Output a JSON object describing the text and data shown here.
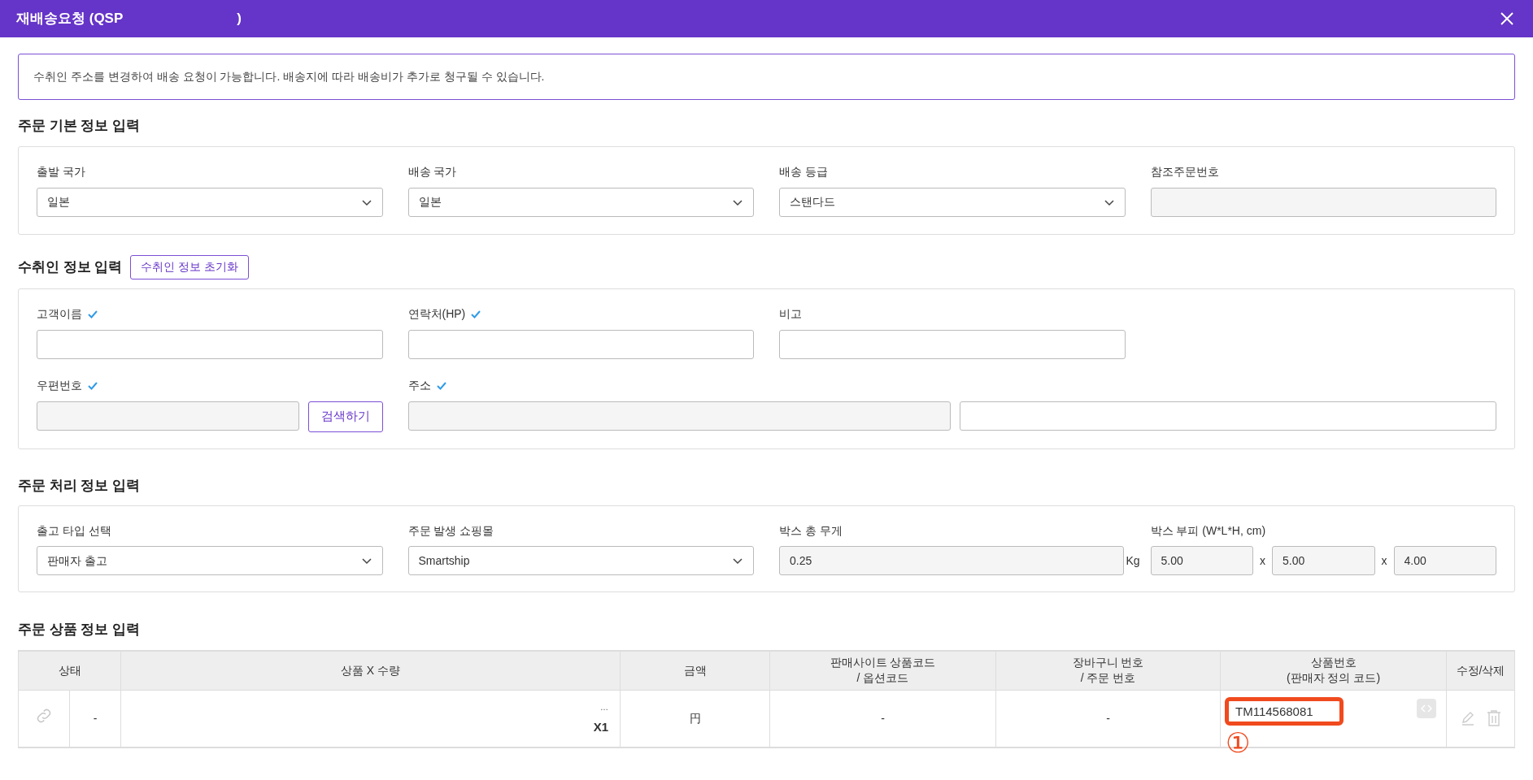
{
  "window": {
    "title": "재배송요청 (QSP",
    "title_end": ")"
  },
  "notice": "수취인 주소를 변경하여 배송 요청이 가능합니다. 배송지에 따라 배송비가 추가로 청구될 수 있습니다.",
  "basic": {
    "title": "주문 기본 정보 입력",
    "fields": [
      {
        "label": "출발 국가",
        "kind": "select",
        "value": "일본",
        "verified": false
      },
      {
        "label": "배송 국가",
        "kind": "select",
        "value": "일본",
        "verified": false
      },
      {
        "label": "배송 등급",
        "kind": "select",
        "value": "스탠다드",
        "verified": false
      },
      {
        "label": "참조주문번호",
        "kind": "readonly",
        "verified": false
      }
    ]
  },
  "recipient": {
    "title": "수취인 정보 입력",
    "reset_button": "수취인 정보 초기화",
    "fields": [
      {
        "label": "고객이름",
        "kind": "text",
        "verified": true
      },
      {
        "label": "연락처(HP)",
        "kind": "text",
        "verified": true
      },
      {
        "label": "비고",
        "kind": "text",
        "verified": false
      }
    ],
    "zip": {
      "label": "우편번호",
      "verified": true,
      "button": "검색하기"
    },
    "address": {
      "label": "주소",
      "verified": true
    }
  },
  "processing": {
    "title": "주문 처리 정보 입력",
    "fields": [
      {
        "label": "출고 타입 선택",
        "kind": "select",
        "value": "판매자 출고",
        "verified": false
      },
      {
        "label": "주문 발생 쇼핑몰",
        "kind": "select",
        "value": "Smartship",
        "verified": false
      }
    ],
    "weight": {
      "label": "박스 총 무게",
      "value": "0.25",
      "unit": "Kg"
    },
    "volume": {
      "label": "박스 부피 (W*L*H, cm)",
      "values": [
        "5.00",
        "5.00",
        "4.00"
      ],
      "separators": [
        "x",
        "x"
      ]
    }
  },
  "products": {
    "title": "주문 상품 정보 입력",
    "columns": [
      {
        "label": "상태"
      },
      {
        "label": "상품 X 수량"
      },
      {
        "label": "금액"
      },
      {
        "label": "판매사이트 상품코드\n/ 옵션코드"
      },
      {
        "label": "장바구니 번호\n/ 주문 번호"
      },
      {
        "label": "상품번호\n(판매자 정의 코드)"
      },
      {
        "label": "수정/삭제"
      }
    ],
    "rows": [
      {
        "status": "-",
        "product": "…",
        "quantity": "X1",
        "price": "円",
        "site_code": "-",
        "cart_number": "-",
        "product_number": "TM114568081",
        "highlighted": true,
        "annotation": "①"
      }
    ]
  }
}
